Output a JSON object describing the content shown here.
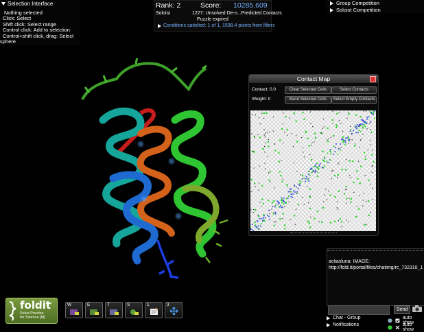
{
  "selection": {
    "title": "Selection Interface",
    "lines": [
      "Nothing selected",
      "Click: Select",
      "Shift click: Select range",
      "Control click: Add to selection",
      "Control+shift click, drag: Select",
      "sphere"
    ]
  },
  "score": {
    "rank": "Rank: 2",
    "score_label": "Score:",
    "score_value": "10285.609",
    "role": "Soloist",
    "puzzle": "1227: Unsolved De-n...Predicted Contacts",
    "expired": "Puzzle expired",
    "conditions": "Conditions satisfied: 1 of 1, 1538.4 points from filters"
  },
  "competition": {
    "group": "Group Competition",
    "soloist": "Soloist Competition"
  },
  "contact_map": {
    "title": "Contact Map",
    "contact_label": "Contact: 0.0",
    "weight_label": "Weight: 0",
    "buttons": {
      "clear": "Clear Selected Cells",
      "select_contacts": "Select Contacts",
      "band": "Band Selected Cells",
      "select_empty": "Select Empty Contacts"
    }
  },
  "chat": {
    "message_user": "actiasluna",
    "message_text": ": IMAGE: http://fold.it/portal/files/chatimg/rc_732310_1",
    "send": "Send",
    "channel": "Chat - Group",
    "notifications": "Notifications",
    "auto_show_1": "auto show",
    "auto_show_2": "auto show"
  },
  "logo": {
    "word": "foldit",
    "version": "beta",
    "tagline_1": "Solve Puzzles",
    "tagline_2": "for Science",
    "tagline_badge": "[M]"
  },
  "tools": [
    {
      "key": "W",
      "icon": "wiggle-icon"
    },
    {
      "key": "E",
      "icon": "wiggle-sidechains-icon"
    },
    {
      "key": "T",
      "icon": "shake-icon"
    },
    {
      "key": "S",
      "icon": "shake-sidechains-icon"
    },
    {
      "key": "1",
      "icon": "notes-icon"
    },
    {
      "key": "3",
      "icon": "move-icon"
    }
  ],
  "colors": {
    "score_blue": "#78b4ff",
    "logo_green": "#6a8c35",
    "contact_green": "#1fd41f",
    "contact_blue": "#3a4fd8"
  }
}
